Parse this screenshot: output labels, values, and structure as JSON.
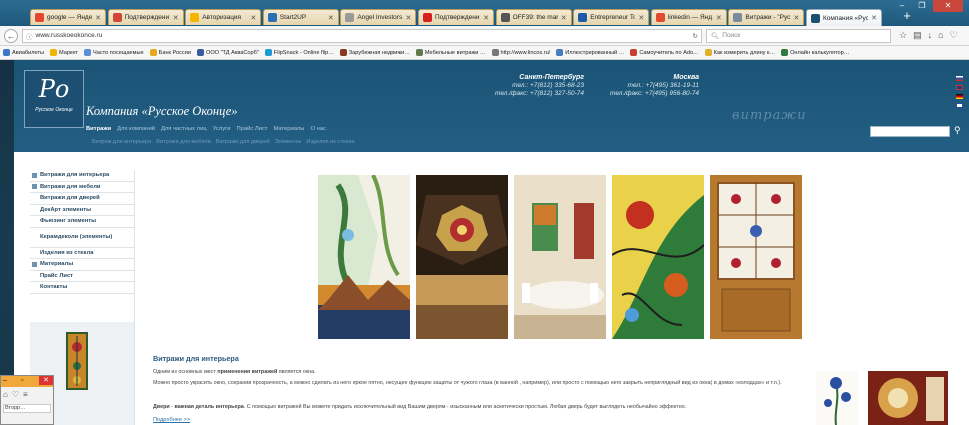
{
  "browser": {
    "tabs": [
      {
        "title": "google — Янде…",
        "color": "#e2492f"
      },
      {
        "title": "Подтверждени…",
        "color": "#d14836"
      },
      {
        "title": "Авторизация",
        "color": "#f4b400"
      },
      {
        "title": "Start2UP",
        "color": "#2a6fb5"
      },
      {
        "title": "Angel Investors …",
        "color": "#9a9a9a"
      },
      {
        "title": "Подтверждени…",
        "color": "#d8201e"
      },
      {
        "title": "OFF39: the mar…",
        "color": "#555555"
      },
      {
        "title": "Entrepreneur To…",
        "color": "#1e5aa8"
      },
      {
        "title": "linkedin — Янд…",
        "color": "#e2492f"
      },
      {
        "title": "Витражи - \"Рус…",
        "color": "#7a8c99"
      },
      {
        "title": "Компания «Рус…",
        "color": "#1c4f71",
        "active": true
      }
    ],
    "new_tab": "+",
    "window_buttons": {
      "minimize": "–",
      "maximize": "❐",
      "close": "✕"
    },
    "url": "www.russkoeokonce.ru",
    "search_placeholder": "Поиск",
    "bookmarks": [
      {
        "label": "Авиабилеты",
        "color": "#3c78c3"
      },
      {
        "label": "Маркет",
        "color": "#f4b400"
      },
      {
        "label": "Часто посещаемые",
        "color": "#5b8fd6"
      },
      {
        "label": "Банк России",
        "color": "#e6a81c"
      },
      {
        "label": "ООО \"ТД АкваСорб\"",
        "color": "#3a5aa0"
      },
      {
        "label": "FlipSnack - Online flip…",
        "color": "#1d9bd7"
      },
      {
        "label": "Зарубежная недвижи…",
        "color": "#8a3a1e"
      },
      {
        "label": "Мебельные витражи …",
        "color": "#5f7d4b"
      },
      {
        "label": "http://www.lincos.ru/",
        "color": "#777777"
      },
      {
        "label": "Иллюстрированный …",
        "color": "#4a7bbf"
      },
      {
        "label": "Самоучитель по Ado…",
        "color": "#c9402f"
      },
      {
        "label": "Как измерить длину к…",
        "color": "#e0b12a"
      },
      {
        "label": "Онлайн калькулятор…",
        "color": "#2f7a3c"
      }
    ]
  },
  "site": {
    "logo_mark": "Ро",
    "logo_caption": "Русское Оконце",
    "company_name": "Компания «Русское Оконце»",
    "contacts": [
      {
        "city": "Санкт-Петербург",
        "line1": "тел.: +7(812) 335-68-23",
        "line2": "тел./факс: +7(812) 327-50-74"
      },
      {
        "city": "Москва",
        "line1": "тел.: +7(495) 361-19-11",
        "line2": "тел./факс: +7(495) 956-80-74"
      }
    ],
    "script_text": "витражи",
    "main_menu": [
      "Витражи",
      "Для компаний",
      "Для частных лиц",
      "Услуги",
      "Прайс Лист",
      "Материалы",
      "О нас"
    ],
    "sub_menu": [
      "Витраж для интерьера",
      "Витражи для мебели",
      "Витражи для дверей",
      "Элементы",
      "Изделия из стекла"
    ],
    "sidebar": [
      {
        "label": "Витражи для интерьера",
        "bullet": true
      },
      {
        "label": "Витражи для мебели",
        "bullet": true
      },
      {
        "label": "Витражи для дверей",
        "bullet": false
      },
      {
        "label": "ДекАрт элементы",
        "bullet": false
      },
      {
        "label": "Фьюзинг элементы",
        "bullet": false
      },
      {
        "label": "Керамдеколи (элементы)",
        "bullet": false,
        "tall": true
      },
      {
        "label": "Изделия из стекла",
        "bullet": false
      },
      {
        "label": "Материалы",
        "bullet": true
      },
      {
        "label": "Прайс Лист",
        "bullet": false
      },
      {
        "label": "Контакты",
        "bullet": false
      }
    ],
    "article": {
      "heading": "Витражи для интерьера",
      "p1_pre": "Одним из основных мест ",
      "p1_bold": "применения витражей",
      "p1_post": " является окна.",
      "p2": "Можно просто украсить окно, сохранив прозрачность, а можно сделать из него яркое пятно, несущее функцию защиты от чужого глаза (в ванной , например), или просто  с помощью него закрыть неприглядный вид из окна( в домах «колодцах» и т.п.).",
      "p3_bold1": "Двери",
      "p3_mid": " - ",
      "p3_bold2": "важная деталь интерьера",
      "p3_post": ". С помощью витражей Вы можете придать исключительный вид Вашим дверям - изысканным или аскетически простым. Любая дверь будет выглядеть необычайно эффектно.",
      "more": "Подробнее >>"
    }
  },
  "overlay": {
    "menu_text": "Вторр…"
  }
}
